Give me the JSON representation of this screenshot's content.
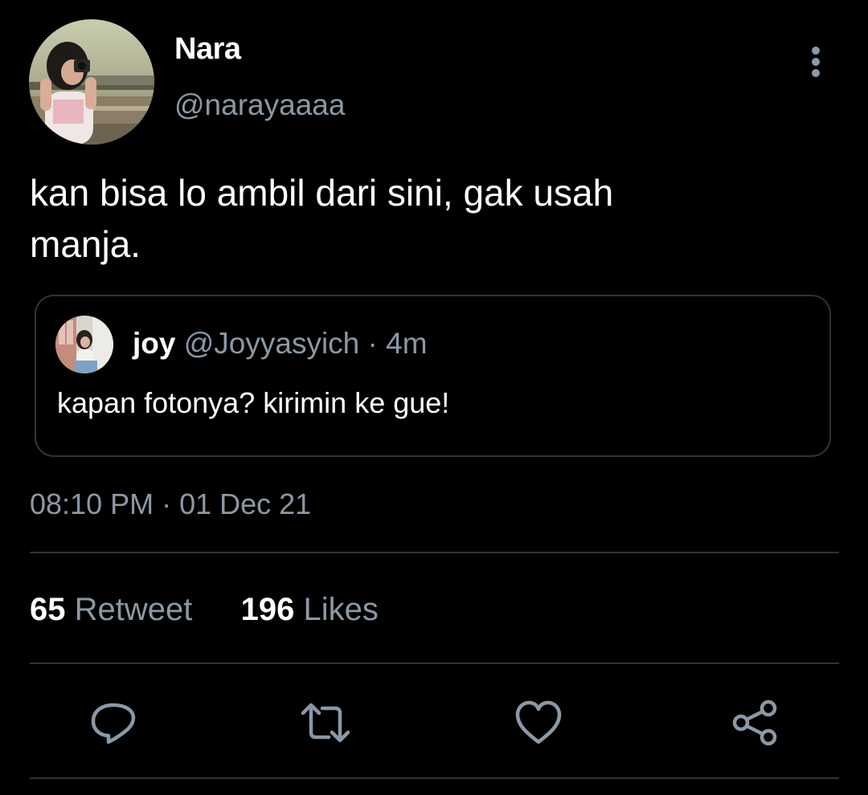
{
  "author": {
    "name": "Nara",
    "handle": "@narayaaaa"
  },
  "tweet_text": "kan bisa lo ambil dari sini, gak usah\nmanja.",
  "quoted_tweet": {
    "name": "joy",
    "handle": "@Joyyasyich",
    "separator": "·",
    "time": "4m",
    "text": "kapan fotonya? kirimin ke gue!"
  },
  "timestamp": "08:10 PM · 01 Dec 21",
  "stats": {
    "retweets": "65",
    "retweets_label": "Retweet",
    "likes": "196",
    "likes_label": "Likes"
  },
  "actions": [
    "reply-icon",
    "retweet-icon",
    "like-icon",
    "share-icon"
  ],
  "colors": {
    "background": "#000000",
    "primary_text": "#ffffff",
    "secondary_text": "#8b98a5",
    "border": "#2f3336"
  }
}
